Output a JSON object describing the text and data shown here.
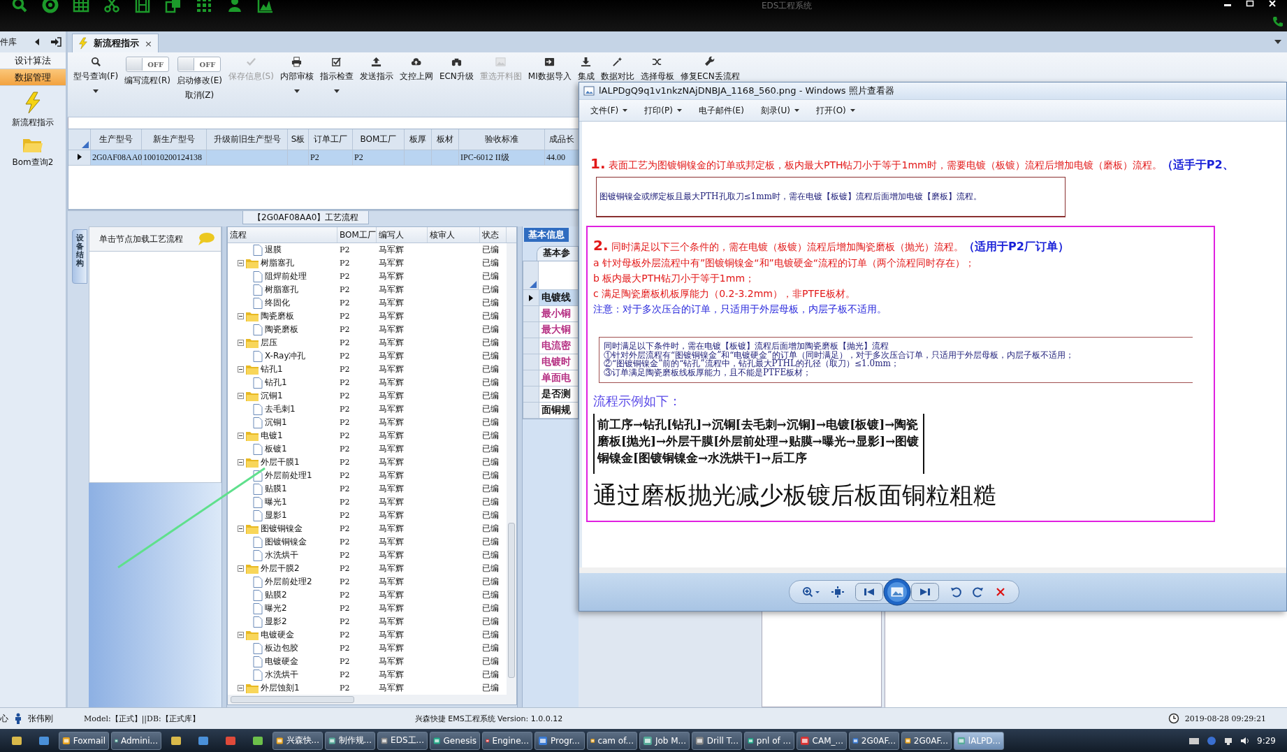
{
  "app": {
    "title": "EDS工程系统"
  },
  "sidebar": {
    "title": "件库",
    "sections": [
      {
        "label": "设计算法",
        "selected": false
      },
      {
        "label": "数据管理",
        "selected": true
      }
    ],
    "shortcuts": [
      {
        "label": "新流程指示"
      },
      {
        "label": "Bom查询2"
      }
    ]
  },
  "tabs": [
    {
      "label": "新流程指示",
      "selected": true,
      "close": "×"
    }
  ],
  "toolbar": [
    {
      "kind": "button",
      "label": "型号查询(F)",
      "disabled": false,
      "dropdown": true
    },
    {
      "kind": "toggle",
      "label": "编写流程(R)",
      "on": false,
      "state_text": "OFF"
    },
    {
      "kind": "toggle",
      "label": "启动修改(E)",
      "sublabel": "取消(Z)",
      "on": false,
      "state_text": "OFF"
    },
    {
      "kind": "button",
      "label": "保存信息(S)",
      "disabled": true,
      "dropdown": false
    },
    {
      "kind": "button",
      "label": "内部审核",
      "disabled": false,
      "dropdown": true
    },
    {
      "kind": "button",
      "label": "指示检查",
      "disabled": false,
      "dropdown": true
    },
    {
      "kind": "button",
      "label": "发送指示",
      "disabled": false,
      "dropdown": false
    },
    {
      "kind": "button",
      "label": "文控上网",
      "disabled": false,
      "dropdown": false
    },
    {
      "kind": "button",
      "label": "ECN升级",
      "disabled": false,
      "dropdown": false
    },
    {
      "kind": "button",
      "label": "重选开料图",
      "disabled": true,
      "dropdown": false
    },
    {
      "kind": "button",
      "label": "MI数据导入",
      "disabled": false,
      "dropdown": false
    },
    {
      "kind": "button",
      "label": "集成",
      "disabled": false,
      "dropdown": false
    },
    {
      "kind": "button",
      "label": "数据对比",
      "disabled": false,
      "dropdown": false
    },
    {
      "kind": "button",
      "label": "选择母板",
      "disabled": false,
      "dropdown": false
    },
    {
      "kind": "button",
      "label": "修复ECN丢流程",
      "disabled": false,
      "dropdown": false
    }
  ],
  "order_grid": {
    "columns": [
      "生产型号",
      "新生产型号",
      "升级前旧生产型号",
      "S板",
      "订单工厂",
      "BOM工厂",
      "板厚",
      "板材",
      "验收标准",
      "成品长"
    ],
    "rows": [
      {
        "selected": true,
        "cells": [
          "2G0AF08AA0",
          "10010200124138",
          null,
          null,
          "P2",
          "P2",
          null,
          null,
          "IPC-6012 II级",
          "44.00"
        ]
      }
    ]
  },
  "process_panel": {
    "title": "【2G0AF08AA0】工艺流程",
    "side_tab": "设备结构",
    "load_hint": "单击节点加载工艺流程",
    "columns": [
      "流程",
      "BOM工厂",
      "编写人",
      "核审人",
      "状态"
    ],
    "nodes": [
      {
        "kind": "file",
        "label": "退膜",
        "factory": "P2",
        "author": "马军辉",
        "status": "已编"
      },
      {
        "kind": "folder",
        "label": "树脂塞孔",
        "factory": "P2",
        "author": "马军辉",
        "status": "已编",
        "expanded": true,
        "children": [
          {
            "kind": "file",
            "label": "阻焊前处理",
            "factory": "P2",
            "author": "马军辉",
            "status": "已编"
          },
          {
            "kind": "file",
            "label": "树脂塞孔",
            "factory": "P2",
            "author": "马军辉",
            "status": "已编"
          },
          {
            "kind": "file",
            "label": "终固化",
            "factory": "P2",
            "author": "马军辉",
            "status": "已编"
          }
        ]
      },
      {
        "kind": "folder",
        "label": "陶瓷磨板",
        "factory": "P2",
        "author": "马军辉",
        "status": "已编",
        "expanded": true,
        "children": [
          {
            "kind": "file",
            "label": "陶瓷磨板",
            "factory": "P2",
            "author": "马军辉",
            "status": "已编"
          }
        ]
      },
      {
        "kind": "folder",
        "label": "层压",
        "factory": "P2",
        "author": "马军辉",
        "status": "已编",
        "expanded": true,
        "children": [
          {
            "kind": "file",
            "label": "X-Ray冲孔",
            "factory": "P2",
            "author": "马军辉",
            "status": "已编"
          }
        ]
      },
      {
        "kind": "folder",
        "label": "钻孔1",
        "factory": "P2",
        "author": "马军辉",
        "status": "已编",
        "expanded": true,
        "children": [
          {
            "kind": "file",
            "label": "钻孔1",
            "factory": "P2",
            "author": "马军辉",
            "status": "已编"
          }
        ]
      },
      {
        "kind": "folder",
        "label": "沉铜1",
        "factory": "P2",
        "author": "马军辉",
        "status": "已编",
        "expanded": true,
        "children": [
          {
            "kind": "file",
            "label": "去毛刺1",
            "factory": "P2",
            "author": "马军辉",
            "status": "已编"
          },
          {
            "kind": "file",
            "label": "沉铜1",
            "factory": "P2",
            "author": "马军辉",
            "status": "已编"
          }
        ]
      },
      {
        "kind": "folder",
        "label": "电镀1",
        "factory": "P2",
        "author": "马军辉",
        "status": "已编",
        "expanded": true,
        "children": [
          {
            "kind": "file",
            "label": "板镀1",
            "factory": "P2",
            "author": "马军辉",
            "status": "已编"
          }
        ]
      },
      {
        "kind": "folder",
        "label": "外层干膜1",
        "factory": "P2",
        "author": "马军辉",
        "status": "已编",
        "expanded": true,
        "children": [
          {
            "kind": "file",
            "label": "外层前处理1",
            "factory": "P2",
            "author": "马军辉",
            "status": "已编"
          },
          {
            "kind": "file",
            "label": "贴膜1",
            "factory": "P2",
            "author": "马军辉",
            "status": "已编"
          },
          {
            "kind": "file",
            "label": "曝光1",
            "factory": "P2",
            "author": "马军辉",
            "status": "已编"
          },
          {
            "kind": "file",
            "label": "显影1",
            "factory": "P2",
            "author": "马军辉",
            "status": "已编"
          }
        ]
      },
      {
        "kind": "folder",
        "label": "图镀铜镍金",
        "factory": "P2",
        "author": "马军辉",
        "status": "已编",
        "expanded": true,
        "children": [
          {
            "kind": "file",
            "label": "图镀铜镍金",
            "factory": "P2",
            "author": "马军辉",
            "status": "已编"
          },
          {
            "kind": "file",
            "label": "水洗烘干",
            "factory": "P2",
            "author": "马军辉",
            "status": "已编"
          }
        ]
      },
      {
        "kind": "folder",
        "label": "外层干膜2",
        "factory": "P2",
        "author": "马军辉",
        "status": "已编",
        "expanded": true,
        "children": [
          {
            "kind": "file",
            "label": "外层前处理2",
            "factory": "P2",
            "author": "马军辉",
            "status": "已编"
          },
          {
            "kind": "file",
            "label": "贴膜2",
            "factory": "P2",
            "author": "马军辉",
            "status": "已编"
          },
          {
            "kind": "file",
            "label": "曝光2",
            "factory": "P2",
            "author": "马军辉",
            "status": "已编"
          },
          {
            "kind": "file",
            "label": "显影2",
            "factory": "P2",
            "author": "马军辉",
            "status": "已编"
          }
        ]
      },
      {
        "kind": "folder",
        "label": "电镀硬金",
        "factory": "P2",
        "author": "马军辉",
        "status": "已编",
        "expanded": true,
        "children": [
          {
            "kind": "file",
            "label": "板边包胶",
            "factory": "P2",
            "author": "马军辉",
            "status": "已编"
          },
          {
            "kind": "file",
            "label": "电镀硬金",
            "factory": "P2",
            "author": "马军辉",
            "status": "已编"
          },
          {
            "kind": "file",
            "label": "水洗烘干",
            "factory": "P2",
            "author": "马军辉",
            "status": "已编"
          }
        ]
      },
      {
        "kind": "folder",
        "label": "外层蚀刻1",
        "factory": "P2",
        "author": "马军辉",
        "status": "已编",
        "expanded": true
      }
    ]
  },
  "info_panel": {
    "tab": "基本信息",
    "subtab": "基本参",
    "rows": [
      {
        "label": "电镀线",
        "color": "#000000",
        "selected": true
      },
      {
        "label": "最小铜",
        "color": "#b0207a",
        "selected": false
      },
      {
        "label": "最大铜",
        "color": "#b0207a",
        "selected": false
      },
      {
        "label": "电流密",
        "color": "#b0207a",
        "selected": false
      },
      {
        "label": "电镀时",
        "color": "#b0207a",
        "selected": false
      },
      {
        "label": "单面电",
        "color": "#b0207a",
        "selected": false
      },
      {
        "label": "是否测",
        "color": "#000000",
        "selected": false
      },
      {
        "label": "面铜规",
        "color": "#000000",
        "selected": false
      }
    ]
  },
  "viewer": {
    "title": "lALPDgQ9q1v1nkzNAjDNBJA_1168_560.png - Windows 照片查看器",
    "menu": [
      {
        "label": "文件(F)",
        "dropdown": true
      },
      {
        "label": "打印(P)",
        "dropdown": true
      },
      {
        "label": "电子邮件(E)",
        "dropdown": false
      },
      {
        "label": "刻录(U)",
        "dropdown": true
      },
      {
        "label": "打开(O)",
        "dropdown": true
      }
    ],
    "document": {
      "rule1": {
        "num": "1.",
        "text": "表面工艺为图镀铜镍金的订单或邦定板，板内最大PTH钻刀小于等于1mm时，需要电镀（板镀）流程后增加电镀（磨板）流程。",
        "scope": "（适手于P2、"
      },
      "rule1_box": "图镀铜镍金或绑定板且最大PTH孔取刀≤1mm时，需在电镀【板镀】流程后面增加电镀【磨板】流程。",
      "rule2": {
        "num": "2.",
        "text": "同时满足以下三个条件的，需在电镀（板镀）流程后增加陶瓷磨板（抛光）流程。",
        "scope": "（适用于P2厂订单）",
        "conditions": [
          "a  针对母板外层流程中有”图镀铜镍金“和”电镀硬金“流程的订单（两个流程同时存在）；",
          "b  板内最大PTH钻刀小于等于1mm；",
          "c  满足陶瓷磨板机板厚能力（0.2-3.2mm），非PTFE板材。"
        ],
        "note": "注意：对于多次压合的订单，只适用于外层母板，内层子板不适用。"
      },
      "rule2_box": [
        "同时满足以下条件时，需在电镀【板镀】流程后面增加陶瓷磨板【抛光】流程",
        "①针对外层流程有“图镀铜镍金”和“电镀硬金”的订单（同时满足），对于多次压合订单，只适用于外层母板，内层子板不适用；",
        "②“图镀铜镍金”前的“钻孔”流程中，钻孔最大PTHL的孔径（取刀）≤1.0mm；",
        "③订单满足陶瓷磨板线板厚能力，且不能是PTFE板材；"
      ],
      "example_title": "流程示例如下：",
      "example_lines": [
        "前工序→钻孔[钻孔]→沉铜[去毛刺→沉铜]→电镀[板镀]→陶瓷",
        "磨板[抛光]→外层干膜[外层前处理→贴膜→曝光→显影]→图镀",
        "铜镍金[图镀铜镍金→水洗烘干]→后工序"
      ],
      "summary": "通过磨板抛光减少板镀后板面铜粒粗糙"
    }
  },
  "status_bar": {
    "left_cut": "心",
    "user": "张伟刚",
    "model": "Model:【正式】||DB:【正式库】",
    "version": "兴森快捷 EMS工程系统 Version: 1.0.0.12",
    "datetime": "2019-08-28 09:29:21"
  },
  "taskbar": {
    "items": [
      {
        "kind": "icon"
      },
      {
        "kind": "icon"
      },
      {
        "kind": "app",
        "label": "Foxmail",
        "selected": false
      },
      {
        "kind": "app",
        "label": "Admini...",
        "selected": false
      },
      {
        "kind": "icon"
      },
      {
        "kind": "icon"
      },
      {
        "kind": "icon"
      },
      {
        "kind": "icon"
      },
      {
        "kind": "app",
        "label": "兴森快...",
        "selected": false
      },
      {
        "kind": "app",
        "label": "制作规...",
        "selected": false
      },
      {
        "kind": "app",
        "label": "EDS工...",
        "selected": false
      },
      {
        "kind": "app",
        "label": "Genesis",
        "selected": false
      },
      {
        "kind": "app",
        "label": "Engine...",
        "selected": false
      },
      {
        "kind": "app",
        "label": "Progr...",
        "selected": false
      },
      {
        "kind": "app",
        "label": "cam of...",
        "selected": false
      },
      {
        "kind": "app",
        "label": "Job M...",
        "selected": false
      },
      {
        "kind": "app",
        "label": "Drill T...",
        "selected": false
      },
      {
        "kind": "app",
        "label": "pnl of ...",
        "selected": false
      },
      {
        "kind": "app",
        "label": "CAM_...",
        "selected": false
      },
      {
        "kind": "app",
        "label": "2G0AF...",
        "selected": false
      },
      {
        "kind": "app",
        "label": "2G0AF...",
        "selected": false
      },
      {
        "kind": "app",
        "label": "lALPD...",
        "selected": true
      }
    ],
    "clock": "9:29"
  }
}
